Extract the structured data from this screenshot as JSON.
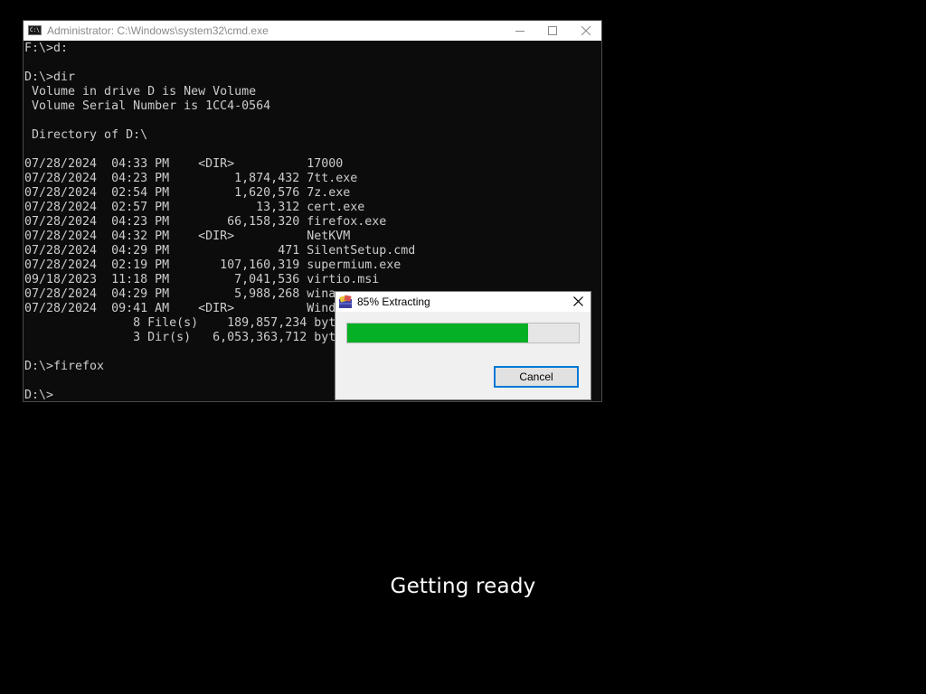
{
  "cmd_window": {
    "title": "Administrator: C:\\Windows\\system32\\cmd.exe",
    "icon_name": "cmd-icon",
    "icon_label": "C:\\",
    "controls": {
      "minimize_icon": "minimize-icon",
      "maximize_icon": "maximize-icon",
      "close_icon": "close-icon"
    },
    "console_lines": [
      "F:\\>d:",
      "",
      "D:\\>dir",
      " Volume in drive D is New Volume",
      " Volume Serial Number is 1CC4-0564",
      "",
      " Directory of D:\\",
      "",
      "07/28/2024  04:33 PM    <DIR>          17000",
      "07/28/2024  04:23 PM         1,874,432 7tt.exe",
      "07/28/2024  02:54 PM         1,620,576 7z.exe",
      "07/28/2024  02:57 PM            13,312 cert.exe",
      "07/28/2024  04:23 PM        66,158,320 firefox.exe",
      "07/28/2024  04:32 PM    <DIR>          NetKVM",
      "07/28/2024  04:29 PM               471 SilentSetup.cmd",
      "07/28/2024  02:19 PM       107,160,319 supermium.exe",
      "09/18/2023  11:18 PM         7,041,536 virtio.msi",
      "07/28/2024  04:29 PM         5,988,268 wina",
      "07/28/2024  09:41 AM    <DIR>          Wind",
      "               8 File(s)    189,857,234 byt",
      "               3 Dir(s)   6,053,363,712 byt",
      "",
      "D:\\>firefox",
      "",
      "D:\\>"
    ]
  },
  "extract_dialog": {
    "title": "85% Extracting",
    "icon_name": "archive-icon",
    "close_icon": "close-icon",
    "progress": 0.78,
    "progress_color": "#06b025",
    "cancel_label": "Cancel"
  },
  "status": {
    "text": "Getting ready"
  }
}
